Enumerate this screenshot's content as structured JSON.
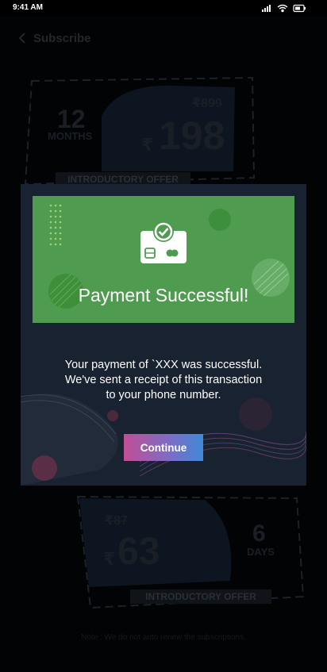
{
  "status_bar": {
    "time": "9:41 AM"
  },
  "nav": {
    "title": "Subscribe"
  },
  "plans": [
    {
      "duration": "12",
      "unit": "MONTHS",
      "old_price": "899",
      "price": "198",
      "offer_label": "INTRODUCTORY OFFER"
    },
    {
      "duration": "6",
      "unit": "DAYS",
      "old_price": "87",
      "price": "63",
      "offer_label": "INTRODUCTORY OFFER"
    }
  ],
  "currency_symbol": "₹",
  "footnote": "Note : We do not auto renew the subscriptions.",
  "modal": {
    "title": "Payment Successful!",
    "message_lines": [
      "Your payment of `XXX was successful.",
      "We've sent a receipt of this transaction",
      "to your phone number."
    ],
    "button_label": "Continue"
  },
  "colors": {
    "banner": "#4f9b4f",
    "modal_bg": "#182230",
    "button_gradient_start": "#c04f95",
    "button_gradient_end": "#3f88d6"
  },
  "icons": {
    "back": "chevron-left-icon",
    "payment": "card-check-icon",
    "signal": "signal-icon",
    "wifi": "wifi-icon",
    "battery": "battery-icon"
  }
}
